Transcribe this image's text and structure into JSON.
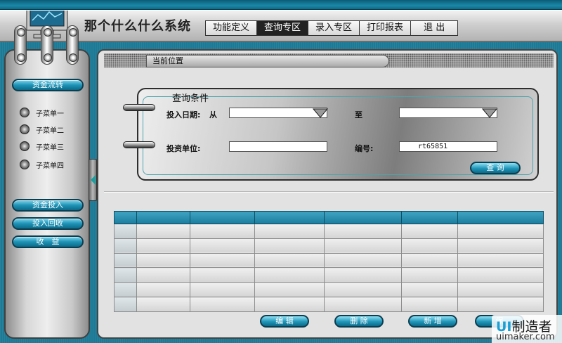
{
  "app": {
    "title": "那个什么什么系统"
  },
  "topnav": {
    "items": [
      {
        "label": "功能定义"
      },
      {
        "label": "查询专区",
        "active": true
      },
      {
        "label": "录入专区"
      },
      {
        "label": "打印报表"
      },
      {
        "label": "退 出"
      }
    ]
  },
  "sidebar": {
    "fund_flow_label": "资金流转",
    "sub_items": [
      {
        "label": "子菜单一"
      },
      {
        "label": "子菜单二"
      },
      {
        "label": "子菜单三"
      },
      {
        "label": "子菜单四"
      }
    ],
    "fund_investment_label": "资金投入",
    "investment_return_label": "投入回收",
    "income_label": "收　益"
  },
  "location": {
    "label": "当前位置"
  },
  "query": {
    "title": "查询条件",
    "date_label": "投入日期:",
    "from_label": "从",
    "to_label": "至",
    "unit_label": "投资单位:",
    "number_label": "编号:",
    "date_from_value": "",
    "date_to_value": "",
    "unit_value": "",
    "number_value": "rt65851",
    "search_button": "查 询"
  },
  "table": {
    "columns": [
      "",
      "",
      "",
      "",
      "",
      "",
      ""
    ],
    "rows": [
      [
        "",
        "",
        "",
        "",
        "",
        "",
        ""
      ],
      [
        "",
        "",
        "",
        "",
        "",
        "",
        ""
      ],
      [
        "",
        "",
        "",
        "",
        "",
        "",
        ""
      ],
      [
        "",
        "",
        "",
        "",
        "",
        "",
        ""
      ],
      [
        "",
        "",
        "",
        "",
        "",
        "",
        ""
      ],
      [
        "",
        "",
        "",
        "",
        "",
        "",
        ""
      ]
    ]
  },
  "actions": {
    "edit": "编 辑",
    "delete": "删 除",
    "add": "新 增",
    "save": "保"
  },
  "watermark": {
    "brand_u": "UI",
    "brand_rest": "制造者",
    "domain": "uimaker.com"
  },
  "colors": {
    "accent": "#1c7d9e",
    "background": "#1d7a96",
    "panel": "#e2e2e2"
  }
}
